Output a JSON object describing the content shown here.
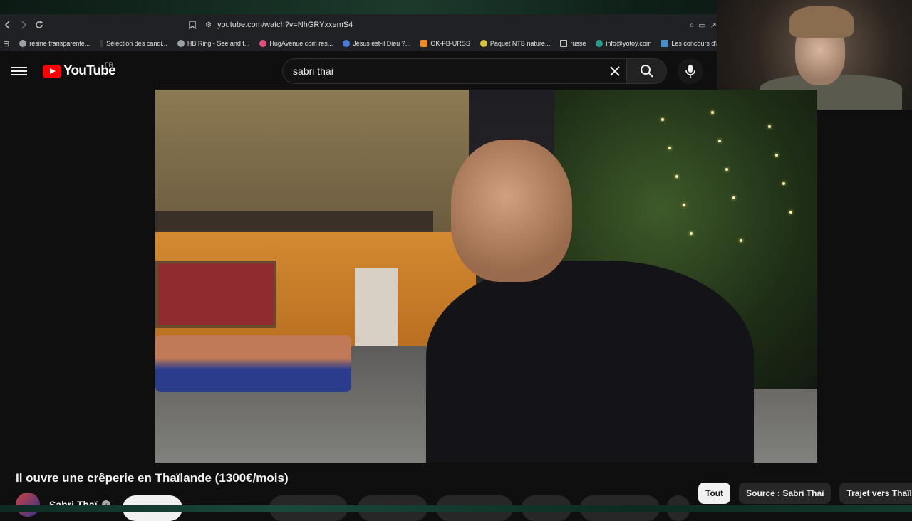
{
  "browser": {
    "url": "youtube.com/watch?v=NhGRYxxemS4",
    "bookmarks": [
      "résine transparente...",
      "Sélection des candi...",
      "HB Ring - See and f...",
      "HugAvenue.com res...",
      "Jésus est-il Dieu ?...",
      "OK-FB-URSS",
      "Paquet NTB nature...",
      "russe",
      "info@yotoy.com",
      "Les concours d'au"
    ]
  },
  "youtube": {
    "logo": "YouTube",
    "region": "FR",
    "search_value": "sabri thai"
  },
  "video": {
    "title": "Il ouvre une crêperie en Thaïlande (1300€/mois)",
    "channel": "Sabri Thaï"
  },
  "chips": [
    "Tout",
    "Source : Sabri Thaï",
    "Trajet vers Thaïlan"
  ],
  "colors": {
    "brand_red": "#ff0000",
    "bg": "#0f0f0f"
  }
}
